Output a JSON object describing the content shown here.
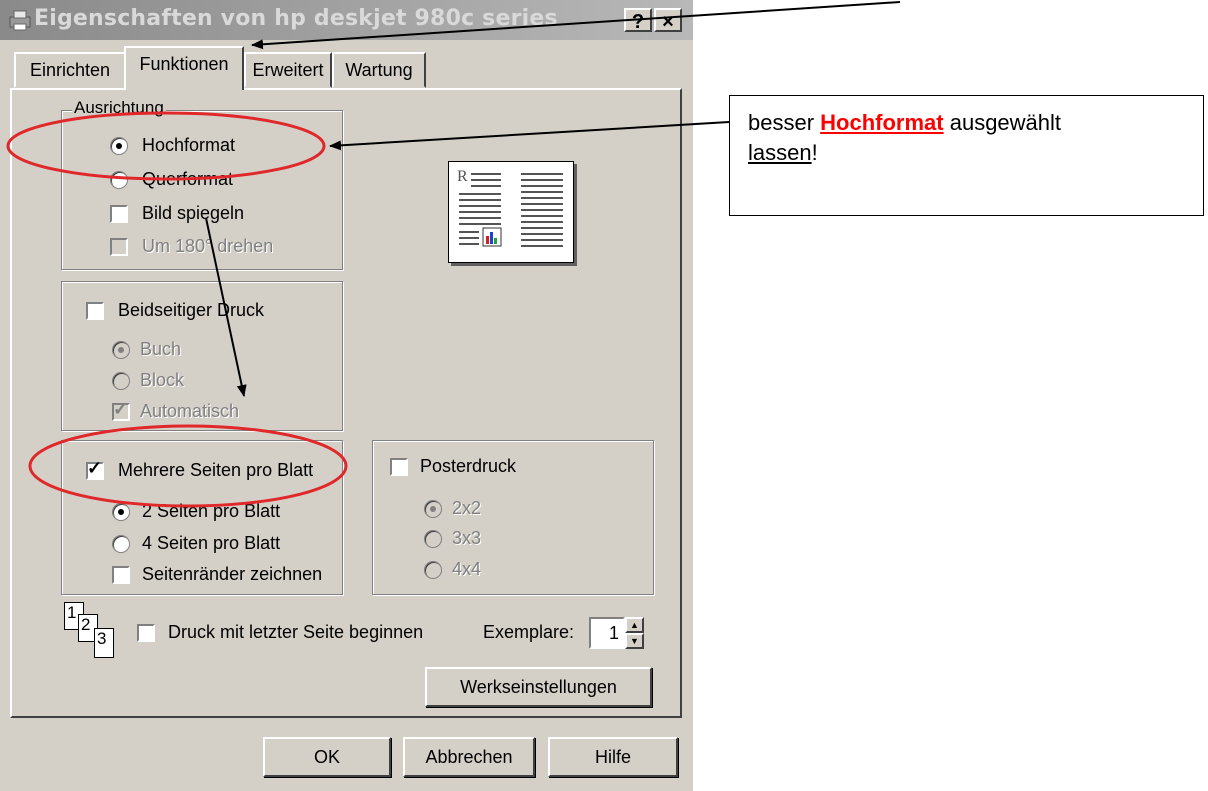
{
  "window": {
    "title": "Eigenschaften von hp deskjet 980c series",
    "help_label": "?",
    "close_label": "×"
  },
  "tabs": [
    {
      "label": "Einrichten"
    },
    {
      "label": "Funktionen"
    },
    {
      "label": "Erweitert"
    },
    {
      "label": "Wartung"
    }
  ],
  "ausrichtung": {
    "legend": "Ausrichtung",
    "hochformat": "Hochformat",
    "querformat": "Querformat",
    "bild_spiegeln": "Bild spiegeln",
    "um_180_drehen": "Um 180° drehen"
  },
  "duplex": {
    "label": "Beidseitiger Druck",
    "buch": "Buch",
    "block": "Block",
    "automatisch": "Automatisch"
  },
  "pages_per_sheet": {
    "label": "Mehrere Seiten pro Blatt",
    "two": "2 Seiten pro Blatt",
    "four": "4 Seiten pro Blatt",
    "borders": "Seitenränder zeichnen"
  },
  "poster": {
    "label": "Posterdruck",
    "o1": "2x2",
    "o2": "3x3",
    "o3": "4x4"
  },
  "preview": {
    "letter": "R"
  },
  "order": {
    "label": "Druck mit letzter Seite beginnen",
    "icon_digits": [
      "1",
      "2",
      "3"
    ]
  },
  "copies": {
    "label": "Exemplare:",
    "value": "1"
  },
  "buttons": {
    "defaults": "Werkseinstellungen",
    "ok": "OK",
    "cancel": "Abbrechen",
    "help": "Hilfe"
  },
  "annotation": {
    "t1": "besser ",
    "t2": "Hochformat",
    "t3": " ausgewählt",
    "t4": "lassen",
    "t5": "!"
  },
  "colors": {
    "dialog_bg": "#d4d0c8",
    "ellipse": "#e0282a",
    "highlight_text": "#ff0000"
  }
}
